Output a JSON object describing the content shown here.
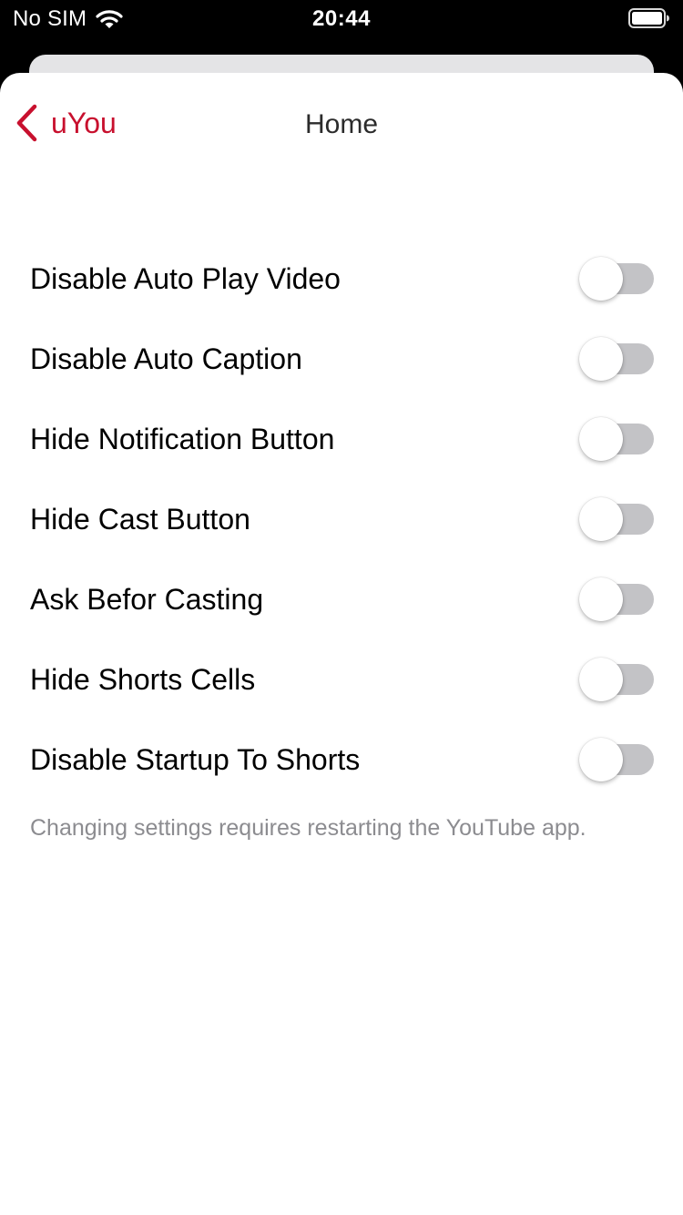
{
  "status_bar": {
    "carrier": "No SIM",
    "time": "20:44"
  },
  "nav": {
    "back_label": "uYou",
    "title": "Home"
  },
  "settings": [
    {
      "label": "Disable Auto Play Video",
      "on": false
    },
    {
      "label": "Disable Auto Caption",
      "on": false
    },
    {
      "label": "Hide Notification Button",
      "on": false
    },
    {
      "label": "Hide Cast Button",
      "on": false
    },
    {
      "label": "Ask Befor Casting",
      "on": false
    },
    {
      "label": "Hide Shorts Cells",
      "on": false
    },
    {
      "label": "Disable Startup To Shorts",
      "on": false
    }
  ],
  "footer_note": "Changing settings requires restarting the YouTube app.",
  "colors": {
    "accent": "#c8102e",
    "toggle_off_track": "#c3c3c6",
    "status_bar_bg": "#000000"
  },
  "icons": {
    "wifi": "wifi-icon",
    "battery": "battery-icon",
    "back": "chevron-left-icon"
  }
}
